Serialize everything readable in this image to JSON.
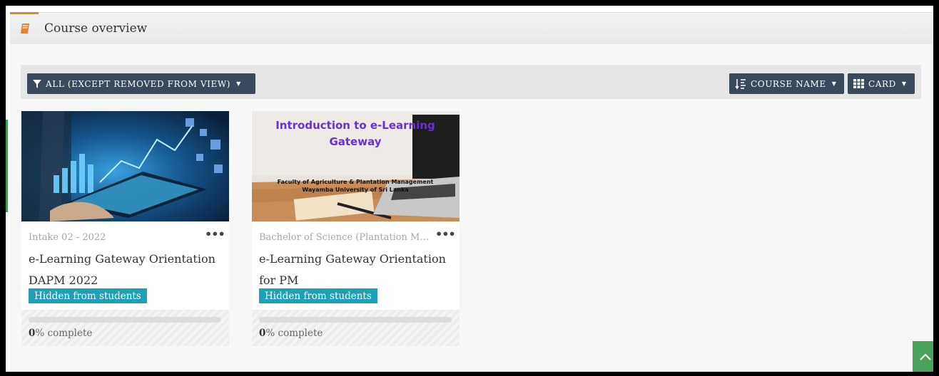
{
  "block": {
    "title": "Course overview"
  },
  "toolbar": {
    "filter_label": "ALL (EXCEPT REMOVED FROM VIEW)",
    "sort_label": "COURSE NAME",
    "view_label": "CARD"
  },
  "courses": [
    {
      "category": "Intake 02 - 2022",
      "title": "e-Learning Gateway Orientation DAPM 2022",
      "badge": "Hidden from students",
      "progress_value": "0",
      "progress_suffix": "% complete",
      "progress": 0
    },
    {
      "category": "Bachelor of Science (Plantation Management)",
      "title": "e-Learning Gateway Orientation for PM",
      "badge": "Hidden from students",
      "progress_value": "0",
      "progress_suffix": "% complete",
      "progress": 0,
      "image_text": {
        "headline1": "Introduction to e-Learning",
        "headline2": "Gateway",
        "sub1": "Faculty of Agriculture & Plantation Management",
        "sub2": "Wayamba University of Sri Lanka"
      }
    }
  ],
  "colors": {
    "accent_orange": "#e8822b",
    "button_dark": "#3a4a5c",
    "badge_teal": "#1ea1b6",
    "scroll_green": "#4aa35a",
    "headline_purple": "#6a2fd9"
  }
}
